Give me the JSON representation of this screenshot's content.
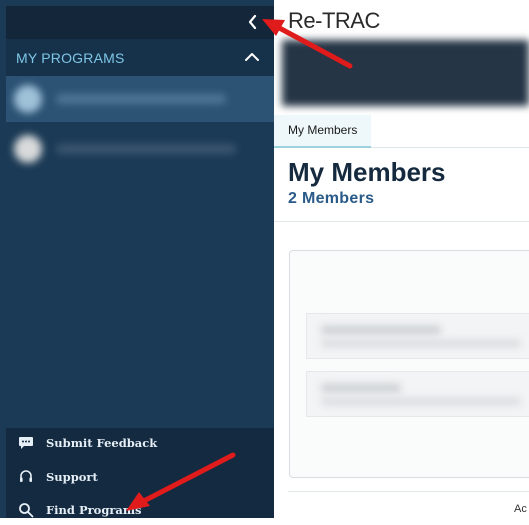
{
  "sidebar": {
    "collapse_glyph": "‹",
    "programs_title": "MY PROGRAMS",
    "links": [
      {
        "label": "Submit Feedback",
        "icon": "chat-icon"
      },
      {
        "label": "Support",
        "icon": "headset-icon"
      },
      {
        "label": "Find Programs",
        "icon": "search-icon"
      }
    ]
  },
  "main": {
    "app_title": "Re-TRAC",
    "tab_label": "My Members",
    "page_title": "My Members",
    "member_count": "2 Members",
    "footer_text": "Ac"
  },
  "colors": {
    "sidebar_bg": "#1b3a55",
    "accent": "#7fc6e6",
    "annotation_arrow": "#e01b1b"
  }
}
